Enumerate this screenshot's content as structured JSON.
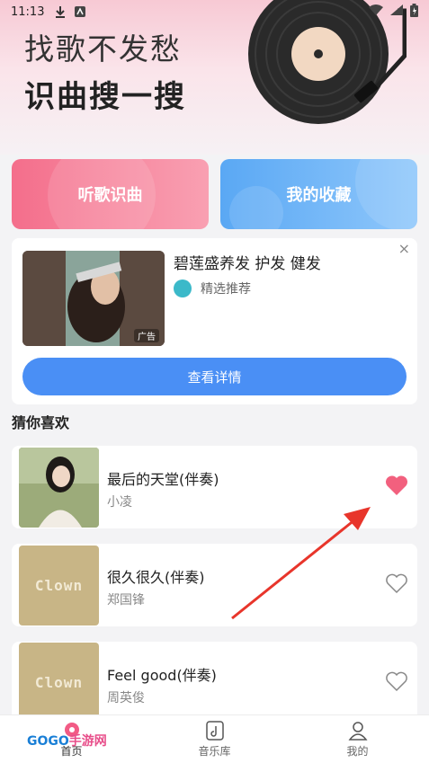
{
  "status_bar": {
    "time": "11:13"
  },
  "hero": {
    "line1": "找歌不发愁",
    "line2": "识曲搜一搜"
  },
  "actions": {
    "listen_label": "听歌识曲",
    "favorites_label": "我的收藏"
  },
  "ad": {
    "title": "碧莲盛养发 护发 健发",
    "tag": "精选推荐",
    "ad_label": "广告",
    "close": "×",
    "button_label": "查看详情"
  },
  "section": {
    "title": "猜你喜欢"
  },
  "songs": [
    {
      "title": "最后的天堂(伴奏)",
      "artist": "小凌",
      "liked": true
    },
    {
      "title": "很久很久(伴奏)",
      "artist": "郑国锋",
      "liked": false
    },
    {
      "title": "Feel good(伴奏)",
      "artist": "周英俊",
      "liked": false
    }
  ],
  "cover_text": "Clown",
  "nav": {
    "home": "首页",
    "library": "音乐库",
    "mine": "我的"
  },
  "watermark": {
    "part1": "GOGO",
    "part2": "手游网"
  },
  "colors": {
    "accent_blue": "#4a8ff5",
    "pink": "#f46e8b",
    "heart_red": "#f2607e"
  }
}
